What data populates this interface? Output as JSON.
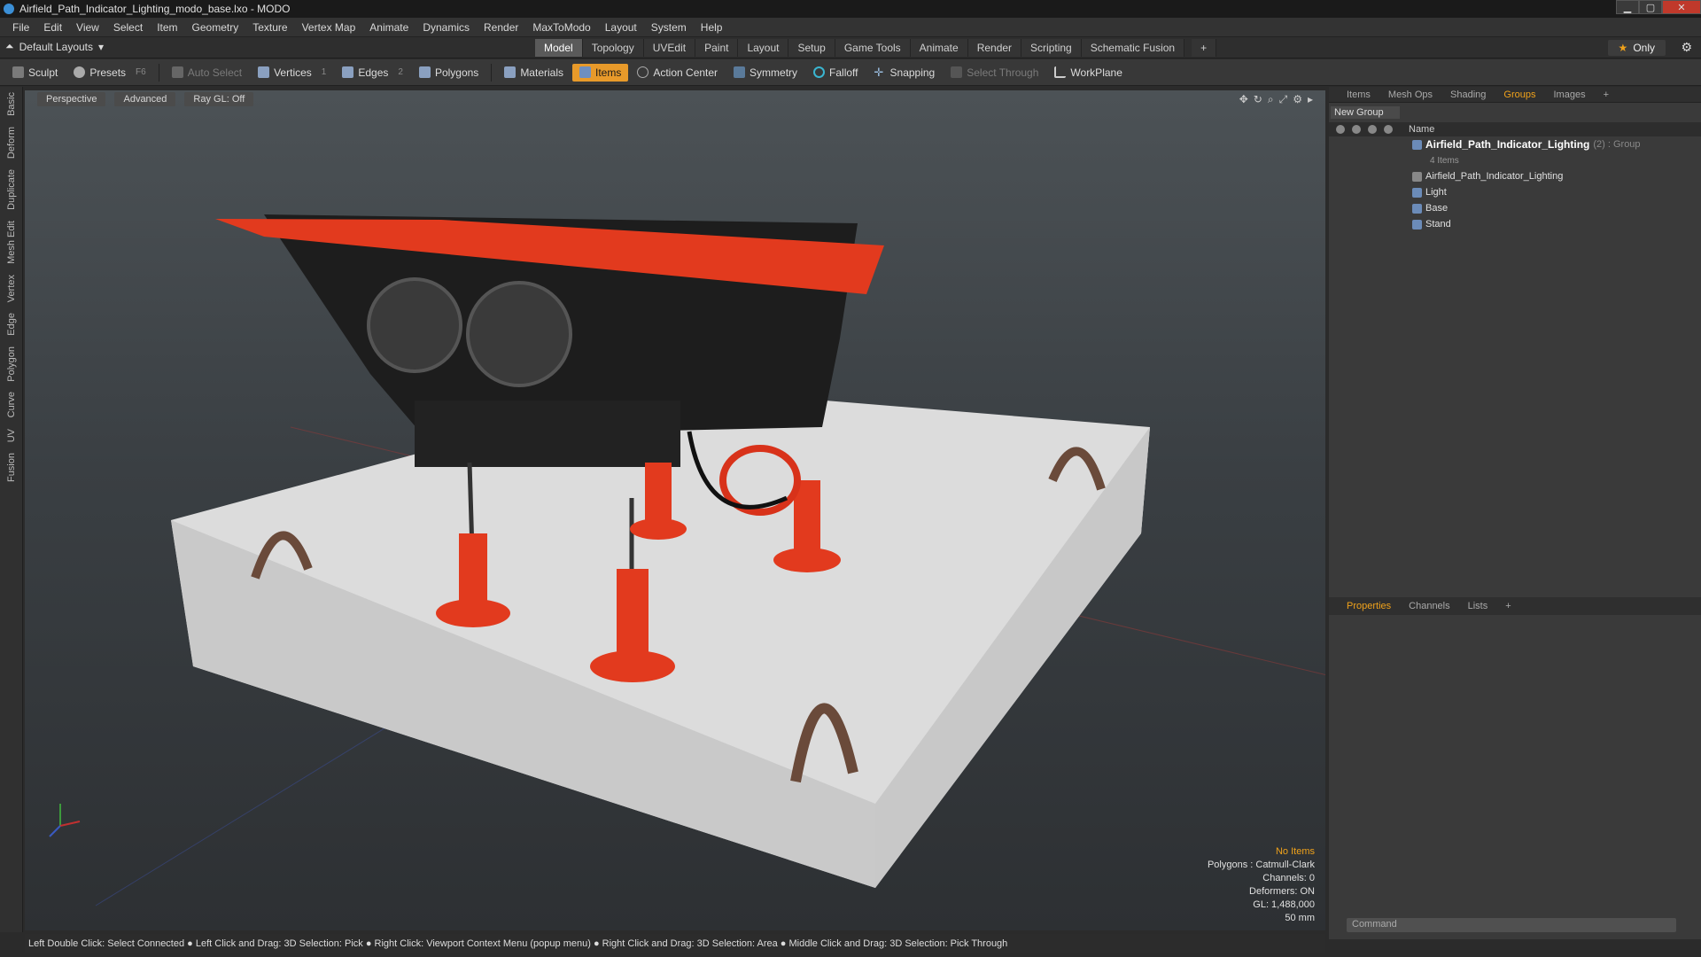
{
  "window": {
    "title": "Airfield_Path_Indicator_Lighting_modo_base.lxo - MODO"
  },
  "menu": [
    "File",
    "Edit",
    "View",
    "Select",
    "Item",
    "Geometry",
    "Texture",
    "Vertex Map",
    "Animate",
    "Dynamics",
    "Render",
    "MaxToModo",
    "Layout",
    "System",
    "Help"
  ],
  "layout": {
    "label": "Default Layouts"
  },
  "tabs": [
    "Model",
    "Topology",
    "UVEdit",
    "Paint",
    "Layout",
    "Setup",
    "Game Tools",
    "Animate",
    "Render",
    "Scripting",
    "Schematic Fusion"
  ],
  "only_label": "Only",
  "toolbar": {
    "sculpt": "Sculpt",
    "presets": "Presets",
    "presets_key": "F6",
    "auto_select": "Auto Select",
    "vertices": "Vertices",
    "vertices_key": "1",
    "edges": "Edges",
    "edges_key": "2",
    "polygons": "Polygons",
    "materials": "Materials",
    "items": "Items",
    "action_center": "Action Center",
    "symmetry": "Symmetry",
    "falloff": "Falloff",
    "snapping": "Snapping",
    "select_through": "Select Through",
    "workplane": "WorkPlane"
  },
  "left_tabs": [
    "Basic",
    "Deform",
    "Duplicate",
    "Mesh Edit",
    "Vertex",
    "Edge",
    "Polygon",
    "Curve",
    "UV",
    "Fusion"
  ],
  "viewport": {
    "perspective": "Perspective",
    "advanced": "Advanced",
    "raygl": "Ray GL: Off",
    "info": {
      "no_items": "No Items",
      "polygons": "Polygons : Catmull-Clark",
      "channels": "Channels: 0",
      "deformers": "Deformers: ON",
      "gl": "GL: 1,488,000",
      "size": "50 mm"
    }
  },
  "status": "Left Double Click: Select Connected ● Left Click and Drag: 3D Selection: Pick ● Right Click: Viewport Context Menu (popup menu) ● Right Click and Drag: 3D Selection: Area ● Middle Click and Drag: 3D Selection: Pick Through",
  "panel": {
    "tabs": [
      "Items",
      "Mesh Ops",
      "Shading",
      "Groups",
      "Images"
    ],
    "new_group": "New Group",
    "name_header": "Name",
    "group_name": "Airfield_Path_Indicator_Lighting",
    "group_suffix": "(2) : Group",
    "group_items": "4 Items",
    "children": [
      "Airfield_Path_Indicator_Lighting",
      "Light",
      "Base",
      "Stand"
    ]
  },
  "props_tabs": [
    "Properties",
    "Channels",
    "Lists"
  ],
  "command_placeholder": "Command"
}
